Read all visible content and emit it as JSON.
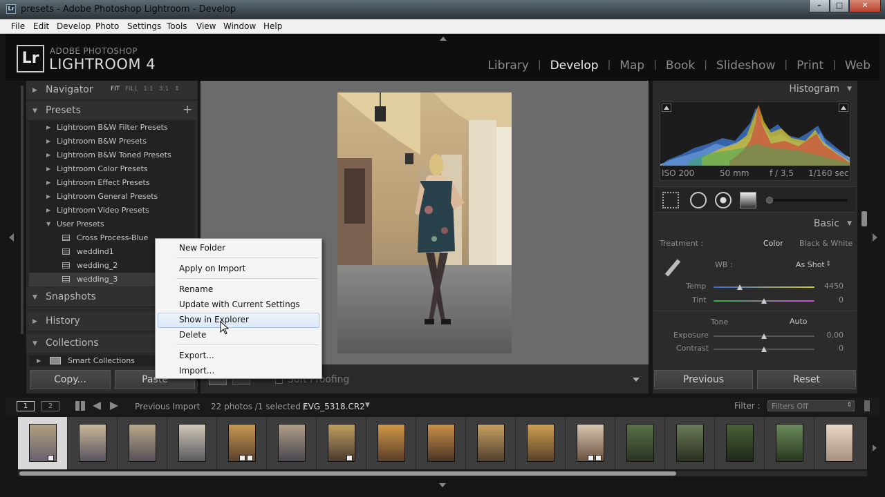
{
  "window": {
    "app_icon": "Lr",
    "title": "presets - Adobe Photoshop Lightroom - Develop",
    "controls": [
      "minimize-icon",
      "maximize-icon",
      "close-icon"
    ]
  },
  "menubar": [
    "File",
    "Edit",
    "Develop",
    "Photo",
    "Settings",
    "Tools",
    "View",
    "Window",
    "Help"
  ],
  "identity": {
    "logo": "Lr",
    "brand_line1": "ADOBE PHOTOSHOP",
    "brand_line2": "LIGHTROOM 4",
    "modules": [
      "Library",
      "Develop",
      "Map",
      "Book",
      "Slideshow",
      "Print",
      "Web"
    ],
    "active_module": "Develop"
  },
  "left_panel": {
    "navigator": {
      "title": "Navigator",
      "options": [
        "FIT",
        "FILL",
        "1:1",
        "3:1"
      ],
      "active_option": "FIT"
    },
    "presets": {
      "title": "Presets",
      "add_icon": "plus-icon",
      "folders": [
        "Lightroom B&W Filter Presets",
        "Lightroom B&W Presets",
        "Lightroom B&W Toned Presets",
        "Lightroom Color Presets",
        "Lightroom Effect Presets",
        "Lightroom General Presets",
        "Lightroom Video Presets",
        "User Presets"
      ],
      "user_presets": [
        "Cross Process-Blue",
        "weddind1",
        "wedding_2",
        "wedding_3"
      ]
    },
    "snapshots": {
      "title": "Snapshots"
    },
    "history": {
      "title": "History"
    },
    "collections": {
      "title": "Collections",
      "items": [
        "Smart Collections"
      ]
    },
    "copy_button": "Copy...",
    "paste_button": "Paste"
  },
  "toolbar": {
    "soft_proofing": "Soft Proofing"
  },
  "context_menu": {
    "items": [
      "New Folder",
      "Apply on Import",
      "Rename",
      "Update with Current Settings",
      "Show in Explorer",
      "Delete",
      "Export...",
      "Import..."
    ],
    "highlighted": "Show in Explorer"
  },
  "right_panel": {
    "histogram": {
      "title": "Histogram",
      "iso": "ISO 200",
      "focal": "50 mm",
      "aperture": "f / 3,5",
      "shutter": "1/160 sec"
    },
    "basic": {
      "title": "Basic",
      "treatment_label": "Treatment :",
      "treatment_color": "Color",
      "treatment_bw": "Black & White",
      "wb_label": "WB :",
      "wb_value": "As Shot",
      "temp_label": "Temp",
      "temp_value": "4450",
      "tint_label": "Tint",
      "tint_value": "0",
      "tone_label": "Tone",
      "auto_label": "Auto",
      "exposure_label": "Exposure",
      "exposure_value": "0,00",
      "contrast_label": "Contrast",
      "contrast_value": "0"
    },
    "previous_button": "Previous",
    "reset_button": "Reset"
  },
  "filmstrip": {
    "page1": "1",
    "page2": "2",
    "source": "Previous Import",
    "count": "22 photos /1 selected /",
    "filename": "EVG_5318.CR2",
    "filter_label": "Filter :",
    "filter_value": "Filters Off"
  }
}
